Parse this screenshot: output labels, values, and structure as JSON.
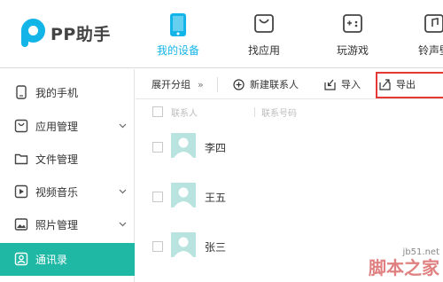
{
  "app": {
    "logo_text": "PP助手",
    "accent_color": "#13b5e8"
  },
  "nav": {
    "items": [
      {
        "label": "我的设备",
        "icon": "phone-icon",
        "active": true
      },
      {
        "label": "找应用",
        "icon": "bag-icon",
        "active": false
      },
      {
        "label": "玩游戏",
        "icon": "gamepad-icon",
        "active": false
      },
      {
        "label": "铃声壁",
        "icon": "ringtone-icon",
        "active": false
      }
    ]
  },
  "sidebar": {
    "active_color": "#1fb8a5",
    "items": [
      {
        "label": "我的手机",
        "icon": "phone-icon",
        "has_chevron": false,
        "active": false
      },
      {
        "label": "应用管理",
        "icon": "bag-icon",
        "has_chevron": true,
        "active": false
      },
      {
        "label": "文件管理",
        "icon": "folder-icon",
        "has_chevron": false,
        "active": false
      },
      {
        "label": "视频音乐",
        "icon": "play-icon",
        "has_chevron": true,
        "active": false
      },
      {
        "label": "照片管理",
        "icon": "image-icon",
        "has_chevron": true,
        "active": false
      },
      {
        "label": "通讯录",
        "icon": "contacts-icon",
        "has_chevron": false,
        "active": true
      }
    ]
  },
  "toolbar": {
    "expand_label": "展开分组",
    "expand_arrows": "»",
    "new_contact_label": "新建联系人",
    "import_label": "导入",
    "export_label": "导出",
    "highlight_color": "#e53935"
  },
  "contacts": {
    "columns": {
      "name": "联系人",
      "phone": "联系号码"
    },
    "rows": [
      {
        "name": "李四"
      },
      {
        "name": "王五"
      },
      {
        "name": "张三"
      }
    ]
  },
  "watermark": {
    "url": "jb51.net",
    "brand": "脚本之家"
  }
}
